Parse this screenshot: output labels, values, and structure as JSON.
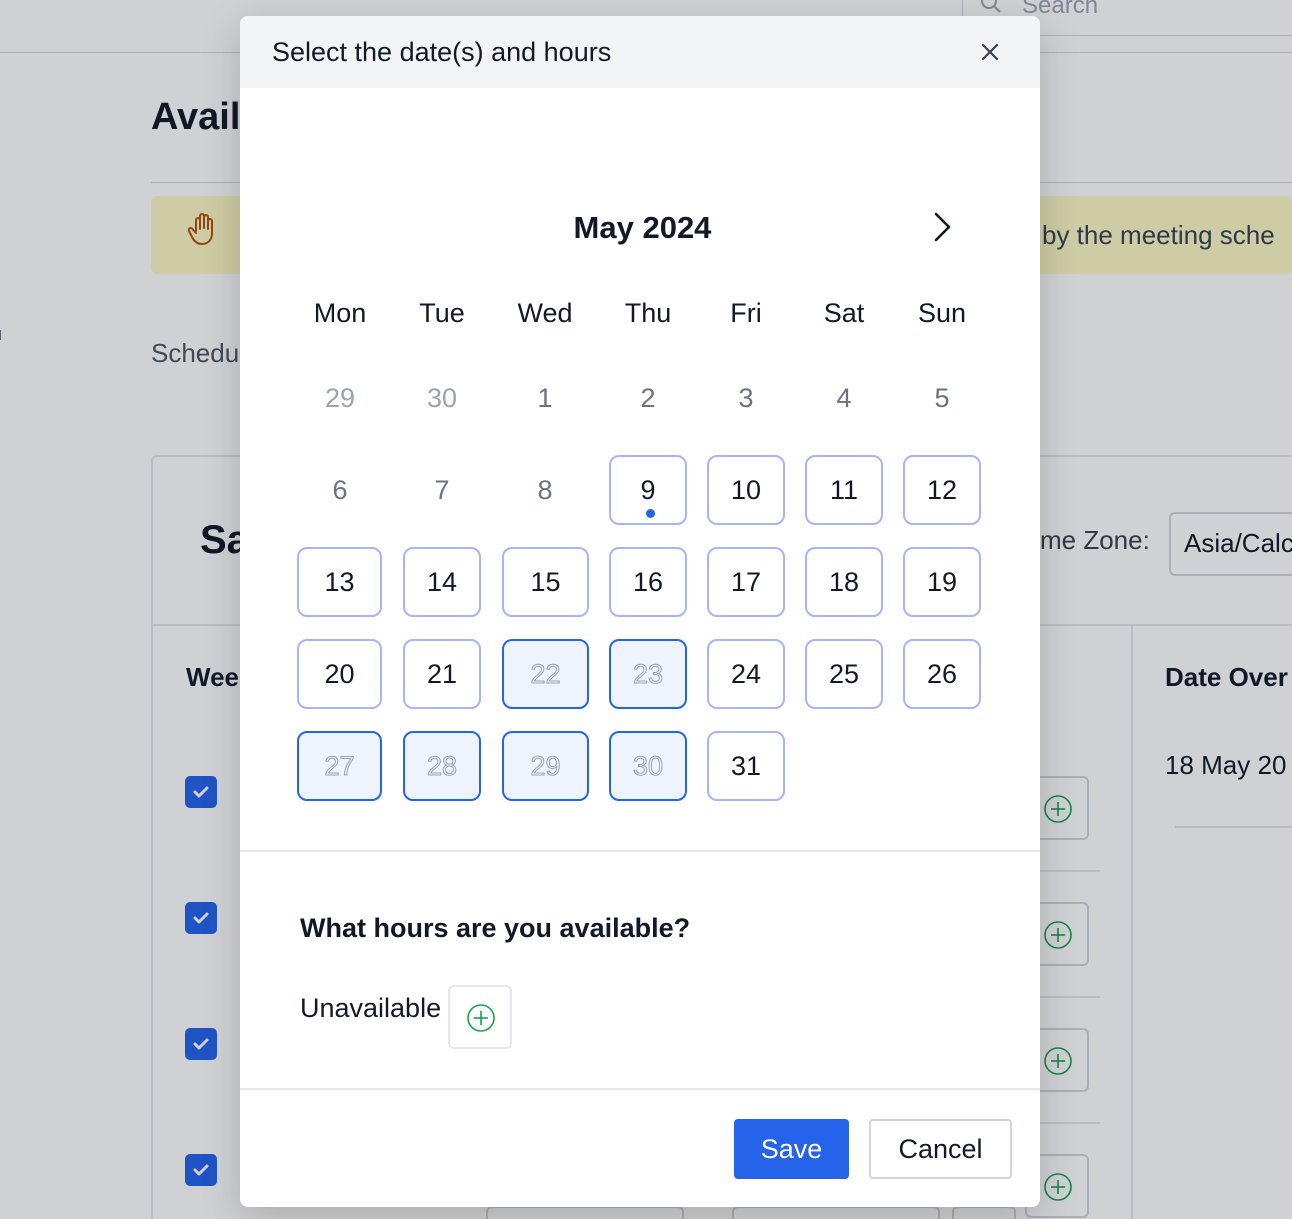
{
  "background": {
    "search_placeholder": "Search",
    "page_title": "Avail",
    "notice_text": "by the meeting sche",
    "schedule_label": "Schedu",
    "card_title": "Sa",
    "timezone_label": "me Zone:",
    "timezone_value": "Asia/Calc",
    "weekly_label": "Wee",
    "date_overrides_label": "Date Over",
    "override_item": "18 May 20"
  },
  "modal": {
    "title": "Select the date(s) and hours",
    "month_label": "May 2024",
    "weekdays": [
      "Mon",
      "Tue",
      "Wed",
      "Thu",
      "Fri",
      "Sat",
      "Sun"
    ],
    "days": [
      "29",
      "30",
      "1",
      "2",
      "3",
      "4",
      "5",
      "6",
      "7",
      "8",
      "9",
      "10",
      "11",
      "12",
      "13",
      "14",
      "15",
      "16",
      "17",
      "18",
      "19",
      "20",
      "21",
      "22",
      "23",
      "24",
      "25",
      "26",
      "27",
      "28",
      "29",
      "30",
      "31"
    ],
    "hours_title": "What hours are you available?",
    "unavailable_label": "Unavailable",
    "save_label": "Save",
    "cancel_label": "Cancel"
  },
  "colors": {
    "accent": "#2563eb",
    "available_border": "#a5b4fc",
    "selected_fill": "#eef4fd",
    "add_icon": "#16a34a",
    "notice_bg": "#fef9c3"
  },
  "icons": {
    "close": "close-icon",
    "next_month": "chevron-right-icon",
    "add_hours": "plus-circle-icon",
    "today_marker": "today-dot-icon"
  }
}
